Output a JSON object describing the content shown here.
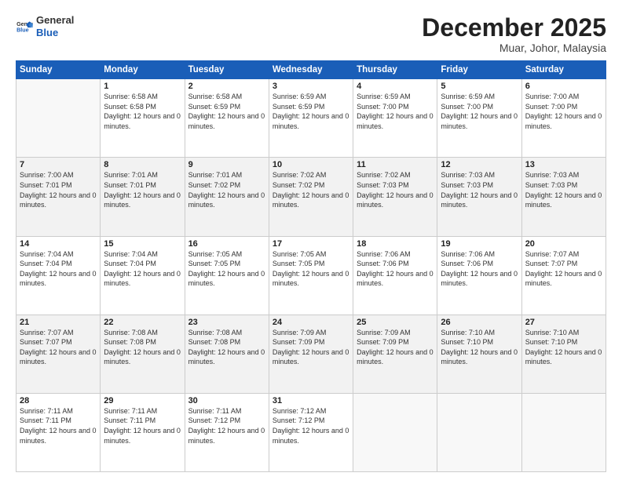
{
  "header": {
    "logo_line1": "General",
    "logo_line2": "Blue",
    "month": "December 2025",
    "location": "Muar, Johor, Malaysia"
  },
  "weekdays": [
    "Sunday",
    "Monday",
    "Tuesday",
    "Wednesday",
    "Thursday",
    "Friday",
    "Saturday"
  ],
  "weeks": [
    [
      {
        "num": "",
        "empty": true
      },
      {
        "num": "1",
        "sunrise": "6:58 AM",
        "sunset": "6:58 PM",
        "daylight": "12 hours and 0 minutes."
      },
      {
        "num": "2",
        "sunrise": "6:58 AM",
        "sunset": "6:59 PM",
        "daylight": "12 hours and 0 minutes."
      },
      {
        "num": "3",
        "sunrise": "6:59 AM",
        "sunset": "6:59 PM",
        "daylight": "12 hours and 0 minutes."
      },
      {
        "num": "4",
        "sunrise": "6:59 AM",
        "sunset": "7:00 PM",
        "daylight": "12 hours and 0 minutes."
      },
      {
        "num": "5",
        "sunrise": "6:59 AM",
        "sunset": "7:00 PM",
        "daylight": "12 hours and 0 minutes."
      },
      {
        "num": "6",
        "sunrise": "7:00 AM",
        "sunset": "7:00 PM",
        "daylight": "12 hours and 0 minutes."
      }
    ],
    [
      {
        "num": "7",
        "sunrise": "7:00 AM",
        "sunset": "7:01 PM",
        "daylight": "12 hours and 0 minutes."
      },
      {
        "num": "8",
        "sunrise": "7:01 AM",
        "sunset": "7:01 PM",
        "daylight": "12 hours and 0 minutes."
      },
      {
        "num": "9",
        "sunrise": "7:01 AM",
        "sunset": "7:02 PM",
        "daylight": "12 hours and 0 minutes."
      },
      {
        "num": "10",
        "sunrise": "7:02 AM",
        "sunset": "7:02 PM",
        "daylight": "12 hours and 0 minutes."
      },
      {
        "num": "11",
        "sunrise": "7:02 AM",
        "sunset": "7:03 PM",
        "daylight": "12 hours and 0 minutes."
      },
      {
        "num": "12",
        "sunrise": "7:03 AM",
        "sunset": "7:03 PM",
        "daylight": "12 hours and 0 minutes."
      },
      {
        "num": "13",
        "sunrise": "7:03 AM",
        "sunset": "7:03 PM",
        "daylight": "12 hours and 0 minutes."
      }
    ],
    [
      {
        "num": "14",
        "sunrise": "7:04 AM",
        "sunset": "7:04 PM",
        "daylight": "12 hours and 0 minutes."
      },
      {
        "num": "15",
        "sunrise": "7:04 AM",
        "sunset": "7:04 PM",
        "daylight": "12 hours and 0 minutes."
      },
      {
        "num": "16",
        "sunrise": "7:05 AM",
        "sunset": "7:05 PM",
        "daylight": "12 hours and 0 minutes."
      },
      {
        "num": "17",
        "sunrise": "7:05 AM",
        "sunset": "7:05 PM",
        "daylight": "12 hours and 0 minutes."
      },
      {
        "num": "18",
        "sunrise": "7:06 AM",
        "sunset": "7:06 PM",
        "daylight": "12 hours and 0 minutes."
      },
      {
        "num": "19",
        "sunrise": "7:06 AM",
        "sunset": "7:06 PM",
        "daylight": "12 hours and 0 minutes."
      },
      {
        "num": "20",
        "sunrise": "7:07 AM",
        "sunset": "7:07 PM",
        "daylight": "12 hours and 0 minutes."
      }
    ],
    [
      {
        "num": "21",
        "sunrise": "7:07 AM",
        "sunset": "7:07 PM",
        "daylight": "12 hours and 0 minutes."
      },
      {
        "num": "22",
        "sunrise": "7:08 AM",
        "sunset": "7:08 PM",
        "daylight": "12 hours and 0 minutes."
      },
      {
        "num": "23",
        "sunrise": "7:08 AM",
        "sunset": "7:08 PM",
        "daylight": "12 hours and 0 minutes."
      },
      {
        "num": "24",
        "sunrise": "7:09 AM",
        "sunset": "7:09 PM",
        "daylight": "12 hours and 0 minutes."
      },
      {
        "num": "25",
        "sunrise": "7:09 AM",
        "sunset": "7:09 PM",
        "daylight": "12 hours and 0 minutes."
      },
      {
        "num": "26",
        "sunrise": "7:10 AM",
        "sunset": "7:10 PM",
        "daylight": "12 hours and 0 minutes."
      },
      {
        "num": "27",
        "sunrise": "7:10 AM",
        "sunset": "7:10 PM",
        "daylight": "12 hours and 0 minutes."
      }
    ],
    [
      {
        "num": "28",
        "sunrise": "7:11 AM",
        "sunset": "7:11 PM",
        "daylight": "12 hours and 0 minutes."
      },
      {
        "num": "29",
        "sunrise": "7:11 AM",
        "sunset": "7:11 PM",
        "daylight": "12 hours and 0 minutes."
      },
      {
        "num": "30",
        "sunrise": "7:11 AM",
        "sunset": "7:12 PM",
        "daylight": "12 hours and 0 minutes."
      },
      {
        "num": "31",
        "sunrise": "7:12 AM",
        "sunset": "7:12 PM",
        "daylight": "12 hours and 0 minutes."
      },
      {
        "num": "",
        "empty": true
      },
      {
        "num": "",
        "empty": true
      },
      {
        "num": "",
        "empty": true
      }
    ]
  ]
}
